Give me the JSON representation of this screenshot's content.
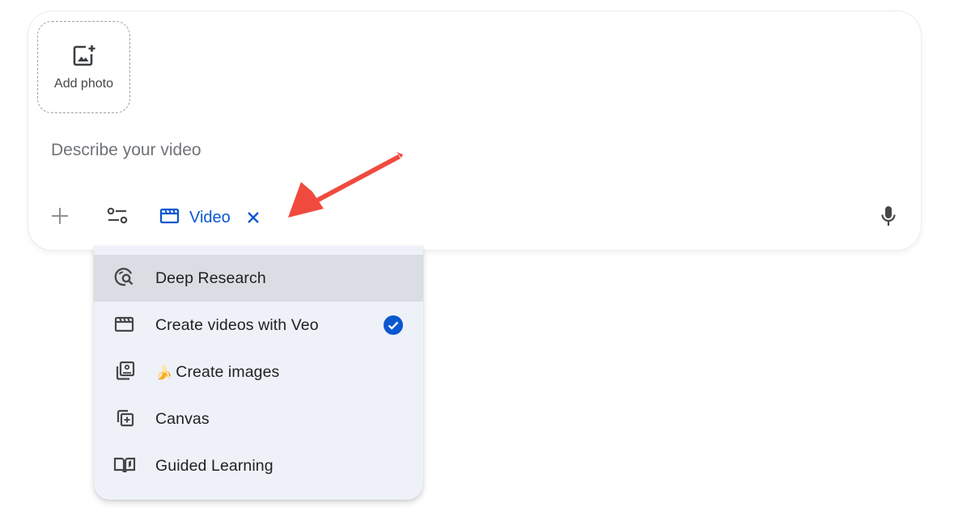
{
  "composer": {
    "add_photo_label": "Add photo",
    "prompt_placeholder": "Describe your video",
    "prompt_value": "",
    "active_tool_chip": {
      "label": "Video",
      "icon": "clapperboard-icon",
      "color": "#0b57d0"
    }
  },
  "tools_menu": {
    "items": [
      {
        "label": "Deep Research",
        "icon": "deep-research-icon",
        "highlighted": true,
        "selected": false
      },
      {
        "label": "Create videos with Veo",
        "icon": "clapperboard-icon",
        "highlighted": false,
        "selected": true
      },
      {
        "label": "Create images",
        "emoji": "🍌",
        "icon": "image-stack-icon",
        "highlighted": false,
        "selected": false
      },
      {
        "label": "Canvas",
        "icon": "canvas-icon",
        "highlighted": false,
        "selected": false
      },
      {
        "label": "Guided Learning",
        "icon": "book-icon",
        "highlighted": false,
        "selected": false
      }
    ]
  },
  "colors": {
    "accent": "#0b57d0",
    "menu_background": "#eef1f8",
    "menu_highlight": "#dadde3",
    "annotation_arrow": "#f04a3e"
  }
}
